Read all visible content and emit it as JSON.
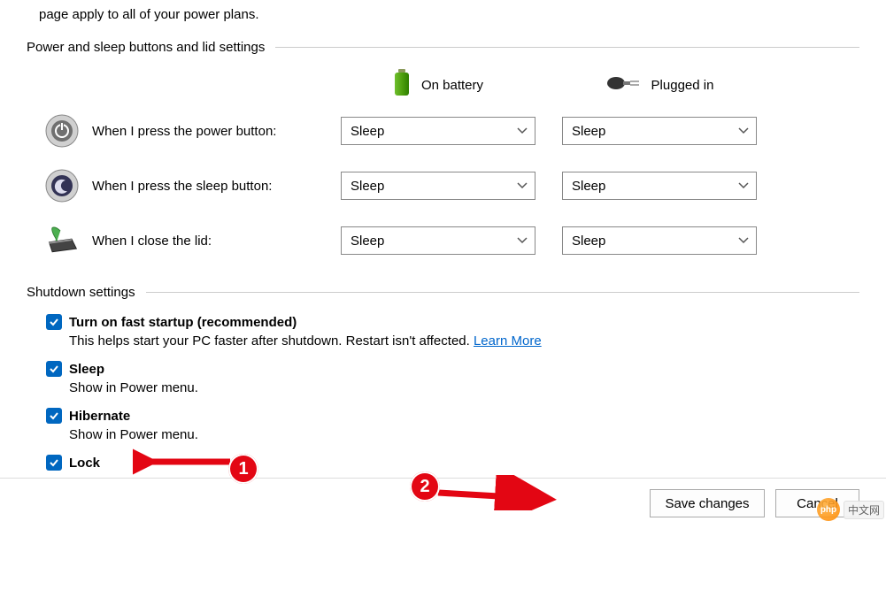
{
  "intro_fragment": "page apply to all of your power plans.",
  "section_power_buttons": "Power and sleep buttons and lid settings",
  "columns": {
    "on_battery": "On battery",
    "plugged_in": "Plugged in"
  },
  "rows": {
    "power_button": {
      "label": "When I press the power button:",
      "battery": "Sleep",
      "plugged": "Sleep"
    },
    "sleep_button": {
      "label": "When I press the sleep button:",
      "battery": "Sleep",
      "plugged": "Sleep"
    },
    "close_lid": {
      "label": "When I close the lid:",
      "battery": "Sleep",
      "plugged": "Sleep"
    }
  },
  "section_shutdown": "Shutdown settings",
  "shutdown": {
    "fast_startup": {
      "label": "Turn on fast startup (recommended)",
      "desc_1": "This helps start your PC faster after shutdown. Restart isn't affected. ",
      "learn_more": "Learn More"
    },
    "sleep": {
      "label": "Sleep",
      "desc": "Show in Power menu."
    },
    "hibernate": {
      "label": "Hibernate",
      "desc": "Show in Power menu."
    },
    "lock": {
      "label": "Lock"
    }
  },
  "buttons": {
    "save": "Save changes",
    "cancel": "Cancel"
  },
  "annotations": {
    "one": "1",
    "two": "2"
  },
  "watermark": {
    "logo": "php",
    "text": "中文网"
  }
}
